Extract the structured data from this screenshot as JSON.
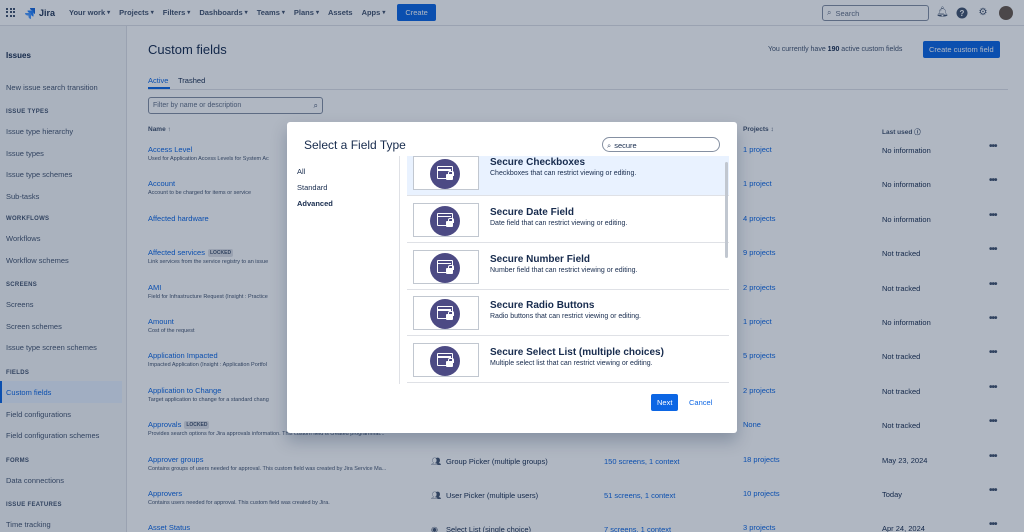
{
  "topnav": {
    "logo": "Jira",
    "items": [
      "Your work",
      "Projects",
      "Filters",
      "Dashboards",
      "Teams",
      "Plans",
      "Assets",
      "Apps"
    ],
    "create_label": "Create",
    "search_placeholder": "Search"
  },
  "sidebar": {
    "title": "Issues",
    "top_item": "New issue search transition",
    "sections": [
      {
        "heading": "ISSUE TYPES",
        "items": [
          "Issue type hierarchy",
          "Issue types",
          "Issue type schemes",
          "Sub-tasks"
        ]
      },
      {
        "heading": "WORKFLOWS",
        "items": [
          "Workflows",
          "Workflow schemes"
        ]
      },
      {
        "heading": "SCREENS",
        "items": [
          "Screens",
          "Screen schemes",
          "Issue type screen schemes"
        ]
      },
      {
        "heading": "FIELDS",
        "items": [
          "Custom fields",
          "Field configurations",
          "Field configuration schemes"
        ]
      },
      {
        "heading": "FORMS",
        "items": [
          "Data connections"
        ]
      },
      {
        "heading": "ISSUE FEATURES",
        "items": [
          "Time tracking"
        ]
      }
    ],
    "active_item": "Custom fields"
  },
  "main": {
    "title": "Custom fields",
    "count_prefix": "You currently have ",
    "count_value": "190",
    "count_suffix": " active custom fields",
    "create_button": "Create custom field",
    "tabs": [
      "Active",
      "Trashed"
    ],
    "filter_placeholder": "Filter by name or description",
    "columns": {
      "name": "Name",
      "projects": "Projects",
      "last_used": "Last used"
    },
    "locked_label": "LOCKED",
    "rows": [
      {
        "name": "Access Level",
        "desc": "Used for Application Access Levels for System Ac",
        "locked": false,
        "type": "",
        "screens": "",
        "projects": "1 project",
        "last_used": "No information"
      },
      {
        "name": "Account",
        "desc": "Account to be charged for items or service",
        "locked": false,
        "type": "",
        "screens": "",
        "projects": "1 project",
        "last_used": "No information"
      },
      {
        "name": "Affected hardware",
        "desc": "",
        "locked": false,
        "type": "",
        "screens": "",
        "projects": "4 projects",
        "last_used": "No information"
      },
      {
        "name": "Affected services",
        "desc": "Link services from the service registry to an issue",
        "locked": true,
        "type": "",
        "screens": "",
        "projects": "9 projects",
        "last_used": "Not tracked"
      },
      {
        "name": "AMI",
        "desc": "Field for Infrastructure Request (Insight : Practice",
        "locked": false,
        "type": "",
        "screens": "",
        "projects": "2 projects",
        "last_used": "Not tracked"
      },
      {
        "name": "Amount",
        "desc": "Cost of the request",
        "locked": false,
        "type": "",
        "screens": "",
        "projects": "1 project",
        "last_used": "No information"
      },
      {
        "name": "Application Impacted",
        "desc": "Impacted Application (Insight : Application Portfol",
        "locked": false,
        "type": "",
        "screens": "",
        "projects": "5 projects",
        "last_used": "Not tracked"
      },
      {
        "name": "Application to Change",
        "desc": "Target application to change for a standard chang",
        "locked": false,
        "type": "",
        "screens": "",
        "projects": "2 projects",
        "last_used": "Not tracked"
      },
      {
        "name": "Approvals",
        "desc": "Provides search options for Jira approvals information. This custom field is created programmat...",
        "locked": true,
        "type": "",
        "screens": "",
        "projects": "None",
        "last_used": "Not tracked"
      },
      {
        "name": "Approver groups",
        "desc": "Contains groups of users needed for approval. This custom field was created by Jira Service Ma...",
        "locked": false,
        "type": "Group Picker (multiple groups)",
        "screens": "150 screens, 1 context",
        "projects": "18 projects",
        "last_used": "May 23, 2024"
      },
      {
        "name": "Approvers",
        "desc": "Contains users needed for approval. This custom field was created by Jira.",
        "locked": false,
        "type": "User Picker (multiple users)",
        "screens": "51 screens, 1 context",
        "projects": "10 projects",
        "last_used": "Today"
      },
      {
        "name": "Asset Status",
        "desc": "",
        "locked": false,
        "type": "Select List (single choice)",
        "screens": "7 screens, 1 context",
        "projects": "3 projects",
        "last_used": "Apr 24, 2024"
      }
    ]
  },
  "modal": {
    "title": "Select a Field Type",
    "search_value": "secure",
    "categories": [
      "All",
      "Standard",
      "Advanced"
    ],
    "active_category": "Advanced",
    "field_types": [
      {
        "name": "Secure Checkboxes",
        "desc": "Checkboxes that can restrict viewing or editing."
      },
      {
        "name": "Secure Date Field",
        "desc": "Date field that can restrict viewing or editing."
      },
      {
        "name": "Secure Number Field",
        "desc": "Number field that can restrict viewing or editing."
      },
      {
        "name": "Secure Radio Buttons",
        "desc": "Radio buttons that can restrict viewing or editing."
      },
      {
        "name": "Secure Select List (multiple choices)",
        "desc": "Multiple select list that can restrict viewing or editing."
      }
    ],
    "next_label": "Next",
    "cancel_label": "Cancel"
  },
  "colors": {
    "accent": "#0c66e4",
    "icon_purple": "#4c4a84",
    "selected_bg": "#e9f2ff"
  }
}
